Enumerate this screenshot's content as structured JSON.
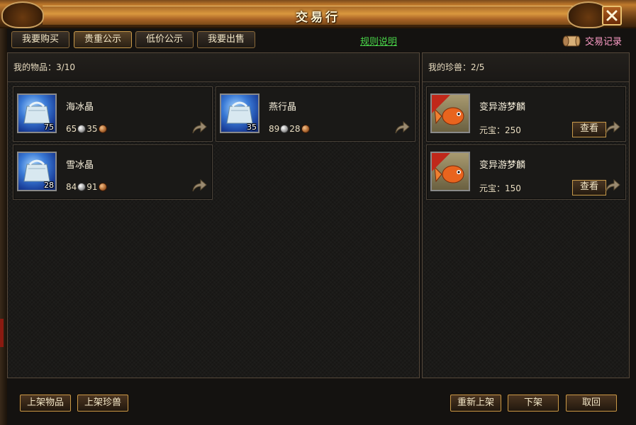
{
  "window": {
    "title": "交易行"
  },
  "tabs": [
    {
      "label": "我要购买"
    },
    {
      "label": "贵重公示"
    },
    {
      "label": "低价公示"
    },
    {
      "label": "我要出售"
    }
  ],
  "rules_link": "规则说明",
  "trade_record": "交易记录",
  "items_panel": {
    "label": "我的物品：",
    "count": "3/10",
    "items": [
      {
        "name": "海冰晶",
        "quantity": "75",
        "silver": "65",
        "copper": "35",
        "icon": "ice-crystal-bag-icon"
      },
      {
        "name": "燕行晶",
        "quantity": "35",
        "silver": "89",
        "copper": "28",
        "icon": "ice-crystal-bag-icon"
      },
      {
        "name": "雪冰晶",
        "quantity": "28",
        "silver": "84",
        "copper": "91",
        "icon": "ice-crystal-bag-icon"
      }
    ]
  },
  "pets_panel": {
    "label": "我的珍兽：",
    "count": "2/5",
    "pets": [
      {
        "name": "变异游梦麟",
        "currency_label": "元宝：",
        "price": "250",
        "view_label": "查看",
        "icon": "goldfish-pet-icon"
      },
      {
        "name": "变异游梦麟",
        "currency_label": "元宝：",
        "price": "150",
        "view_label": "查看",
        "icon": "goldfish-pet-icon"
      }
    ]
  },
  "bottom_buttons": {
    "list_item": "上架物品",
    "list_pet": "上架珍兽",
    "relist": "重新上架",
    "delist": "下架",
    "retrieve": "取回"
  },
  "colors": {
    "rules_link": "#4ad64a",
    "trade_record": "#ff9ec8",
    "accent_gold": "#c89a4a"
  }
}
